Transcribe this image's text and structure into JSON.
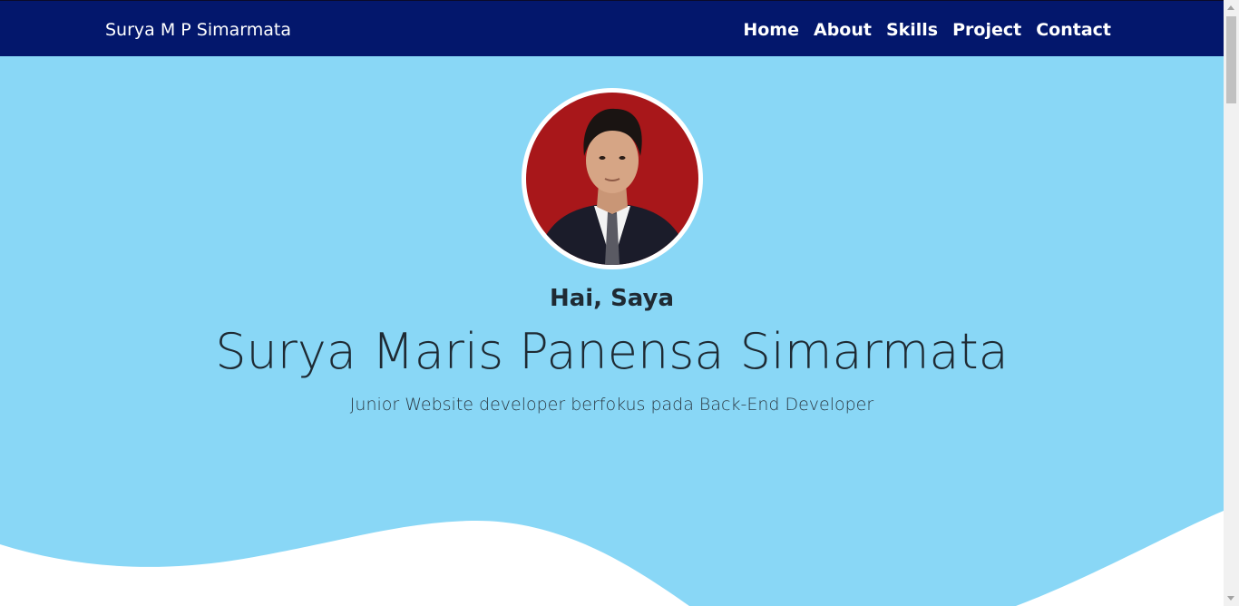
{
  "navbar": {
    "brand": "Surya M P Simarmata",
    "links": [
      {
        "label": "Home"
      },
      {
        "label": "About"
      },
      {
        "label": "Skills"
      },
      {
        "label": "Project"
      },
      {
        "label": "Contact"
      }
    ]
  },
  "hero": {
    "greeting": "Hai, Saya",
    "name": "Surya Maris Panensa Simarmata",
    "tagline": "Junior Website developer berfokus pada Back-End Developer",
    "avatar_icon": "profile-photo",
    "colors": {
      "navbar_bg": "#03176c",
      "hero_bg": "#89d7f6",
      "wave": "#ffffff",
      "avatar_bg": "#a8171a"
    }
  }
}
